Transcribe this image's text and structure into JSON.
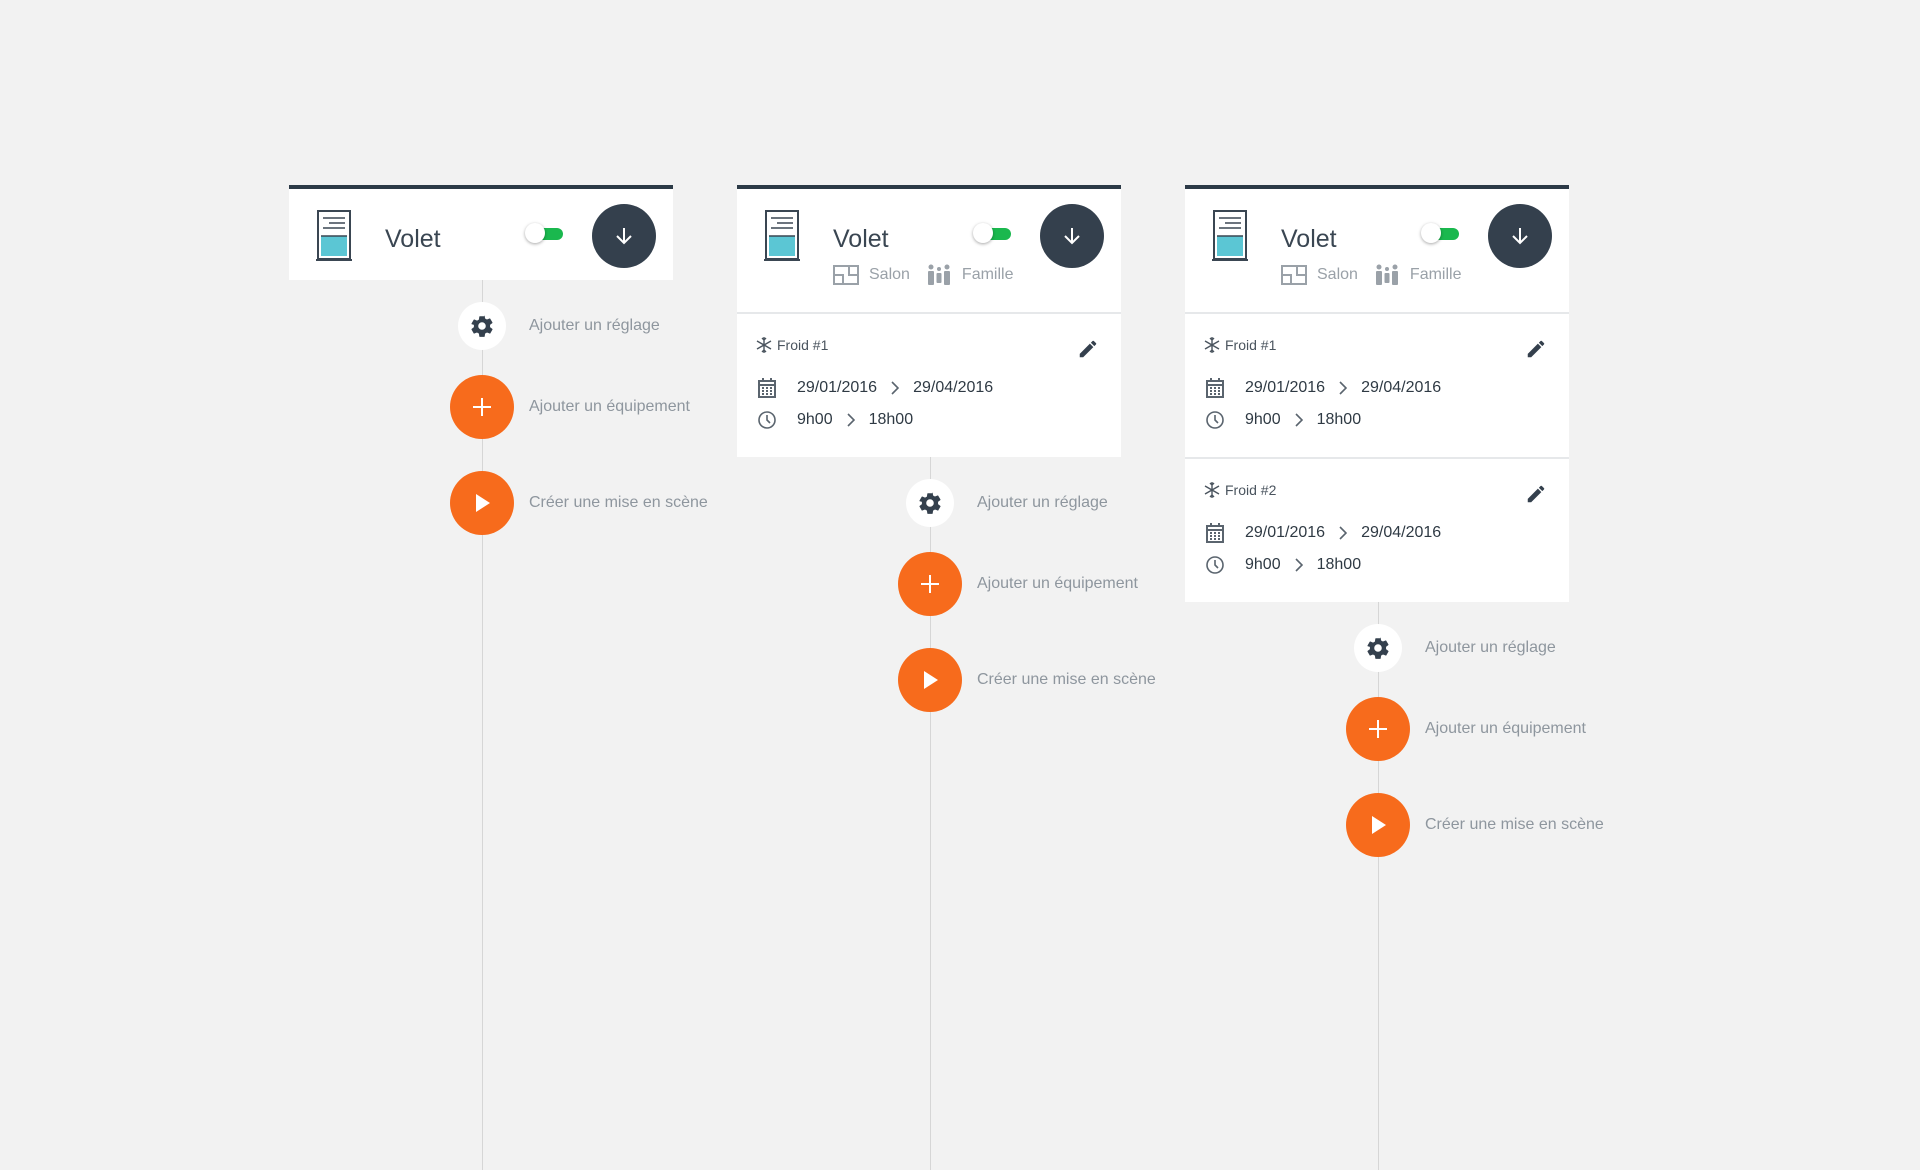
{
  "colors": {
    "background": "#f2f2f2",
    "card": "#ffffff",
    "card_border": "#2c3a47",
    "dark_button": "#34404d",
    "accent_orange": "#f76b1c",
    "toggle_on": "#1ab84e",
    "label_grey": "#8e969e"
  },
  "cards": [
    {
      "device": {
        "title": "Volet",
        "icon": "window-shutter-icon",
        "toggle_on": true
      },
      "meta": null,
      "settings": [],
      "actions": {
        "add_setting": "Ajouter un réglage",
        "add_equipment": "Ajouter un équipement",
        "create_scene": "Créer une mise en scène"
      }
    },
    {
      "device": {
        "title": "Volet",
        "icon": "window-shutter-icon",
        "toggle_on": true
      },
      "meta": {
        "room": "Salon",
        "group": "Famille"
      },
      "settings": [
        {
          "name": "Froid #1",
          "date_start": "29/01/2016",
          "date_end": "29/04/2016",
          "time_start": "9h00",
          "time_end": "18h00"
        }
      ],
      "actions": {
        "add_setting": "Ajouter un réglage",
        "add_equipment": "Ajouter un équipement",
        "create_scene": "Créer une mise en scène"
      }
    },
    {
      "device": {
        "title": "Volet",
        "icon": "window-shutter-icon",
        "toggle_on": true
      },
      "meta": {
        "room": "Salon",
        "group": "Famille"
      },
      "settings": [
        {
          "name": "Froid #1",
          "date_start": "29/01/2016",
          "date_end": "29/04/2016",
          "time_start": "9h00",
          "time_end": "18h00"
        },
        {
          "name": "Froid #2",
          "date_start": "29/01/2016",
          "date_end": "29/04/2016",
          "time_start": "9h00",
          "time_end": "18h00"
        }
      ],
      "actions": {
        "add_setting": "Ajouter un réglage",
        "add_equipment": "Ajouter un équipement",
        "create_scene": "Créer une mise en scène"
      }
    }
  ]
}
